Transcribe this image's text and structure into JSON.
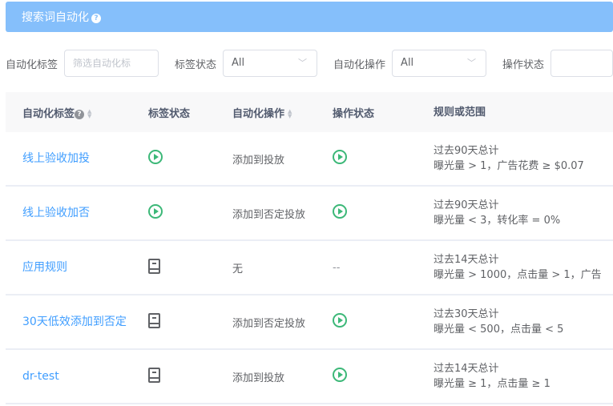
{
  "banner": {
    "title": "搜索词自动化",
    "help_icon": "question-circle-icon"
  },
  "filters": {
    "tag_label": "自动化标签",
    "tag_placeholder": "筛选自动化标",
    "tag_status_label": "标签状态",
    "tag_status_value": "All",
    "action_label": "自动化操作",
    "action_value": "All",
    "op_status_label": "操作状态"
  },
  "table": {
    "headers": [
      "自动化标签",
      "标签状态",
      "自动化操作",
      "操作状态",
      "规则或范围"
    ],
    "rows": [
      {
        "tag": "线上验收加投",
        "tag_status": "play",
        "action": "添加到投放",
        "op_status": "play",
        "op_text": "",
        "rule1": "过去90天总计",
        "rule2": "曝光量 > 1，广告花费 ≥ $0.07"
      },
      {
        "tag": "线上验收加否",
        "tag_status": "play",
        "action": "添加到否定投放",
        "op_status": "play",
        "op_text": "",
        "rule1": "过去90天总计",
        "rule2": "曝光量 < 3，转化率 = 0%"
      },
      {
        "tag": "应用规则",
        "tag_status": "doc",
        "action": "无",
        "op_status": "none",
        "op_text": "--",
        "rule1": "过去14天总计",
        "rule2": "曝光量 > 1000，点击量 > 1，广告"
      },
      {
        "tag": "30天低效添加到否定",
        "tag_status": "doc",
        "action": "添加到否定投放",
        "op_status": "play",
        "op_text": "",
        "rule1": "过去30天总计",
        "rule2": "曝光量 < 500，点击量 < 5"
      },
      {
        "tag": "dr-test",
        "tag_status": "doc",
        "action": "添加到投放",
        "op_status": "play",
        "op_text": "",
        "rule1": "过去14天总计",
        "rule2": "曝光量 ≥ 1，点击量 ≥ 1"
      }
    ]
  },
  "colors": {
    "banner": "#85bffb",
    "link": "#409eff",
    "active": "#3cb878"
  }
}
